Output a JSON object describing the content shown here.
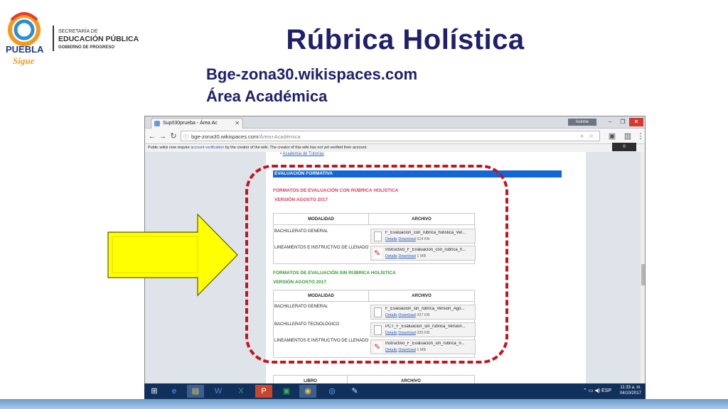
{
  "slide": {
    "title": "Rúbrica  Holística",
    "subtitle_line1": "Bge-zona30.wikispaces.com",
    "subtitle_line2": "Área Académica"
  },
  "logo": {
    "brand_line1": "PUEBLA",
    "brand_line2": "Sigue",
    "org_line1": "SECRETARÍA DE",
    "org_line2": "EDUCACIÓN PÚBLICA",
    "org_line3": "GOBIERNO DE PROGRESO"
  },
  "browser": {
    "tab_title": "Sup030prueba - Área Ac",
    "user": "Ivonne",
    "url_host": "bge-zona30.wikispaces.com",
    "url_path": "/Área+Académica",
    "notice_prefix": "Public wikis now require ",
    "notice_link": "account verification",
    "notice_suffix": " by the creator of the wiki. The creator of this wiki has not yet verified their account.",
    "zoom_chip": "0"
  },
  "page": {
    "tutorias_link": "Academia de Tutorías",
    "eval_header": "EVALUACIÓN FORMATIVA",
    "section1": {
      "title": "FORMATOS DE EVALUACIÓN CON RÚBRICA HOLÍSTICA",
      "version": "VERSIÓN AGOSTO 2017",
      "col1": "MODALIDAD",
      "col2": "ARCHIVO",
      "rows": [
        {
          "modalidad": "BACHILLERATO GENERAL",
          "file": "F_Evaluacion_con_rubrica_holistica_Ver...",
          "size": "514 KB",
          "type": "doc"
        },
        {
          "modalidad": "LINEAMIENTOS E INSTRUCTIVO DE LLENADO",
          "file": "Instructivo_F_Evaluacion_con_rubrica_h...",
          "size": "1 MB",
          "type": "pdf"
        }
      ]
    },
    "section2": {
      "title": "FORMATOS DE EVALUACIÓN SIN RÚBRICA HOLÍSTICA",
      "version": "VERSIÓN AGOSTO 2017",
      "col1": "MODALIDAD",
      "col2": "ARCHIVO",
      "rows": [
        {
          "modalidad": "BACHILLERATO GENERAL",
          "file": "F_Evaluacion_sin_rubrica_Version_Ago...",
          "size": "337 KB",
          "type": "doc"
        },
        {
          "modalidad": "BACHILLERATO TECNOLÓGICO",
          "file": "PCT_F_Evaluacion_sin_rubrica_Version...",
          "size": "335 KB",
          "type": "doc"
        },
        {
          "modalidad": "LINEAMIENTOS E INSTRUCTIVO DE LLENADO",
          "file": "Instructivo_F_Evaluacion_sin_rubrica_V...",
          "size": "1 MB",
          "type": "pdf"
        }
      ]
    },
    "section3": {
      "col1": "LIBRO",
      "col2": "ARCHIVO"
    },
    "details_label": "Details",
    "download_label": "Download"
  },
  "taskbar": {
    "lang": "ESP",
    "time": "11:33 a. m.",
    "date": "04/10/2017"
  },
  "colors": {
    "title": "#1f1f6b",
    "dash": "#c4141d",
    "arrow_fill": "#ffff00",
    "eval_bar": "#1366d6",
    "red_heading": "#d23a5a",
    "green_heading": "#2f9a2f"
  }
}
